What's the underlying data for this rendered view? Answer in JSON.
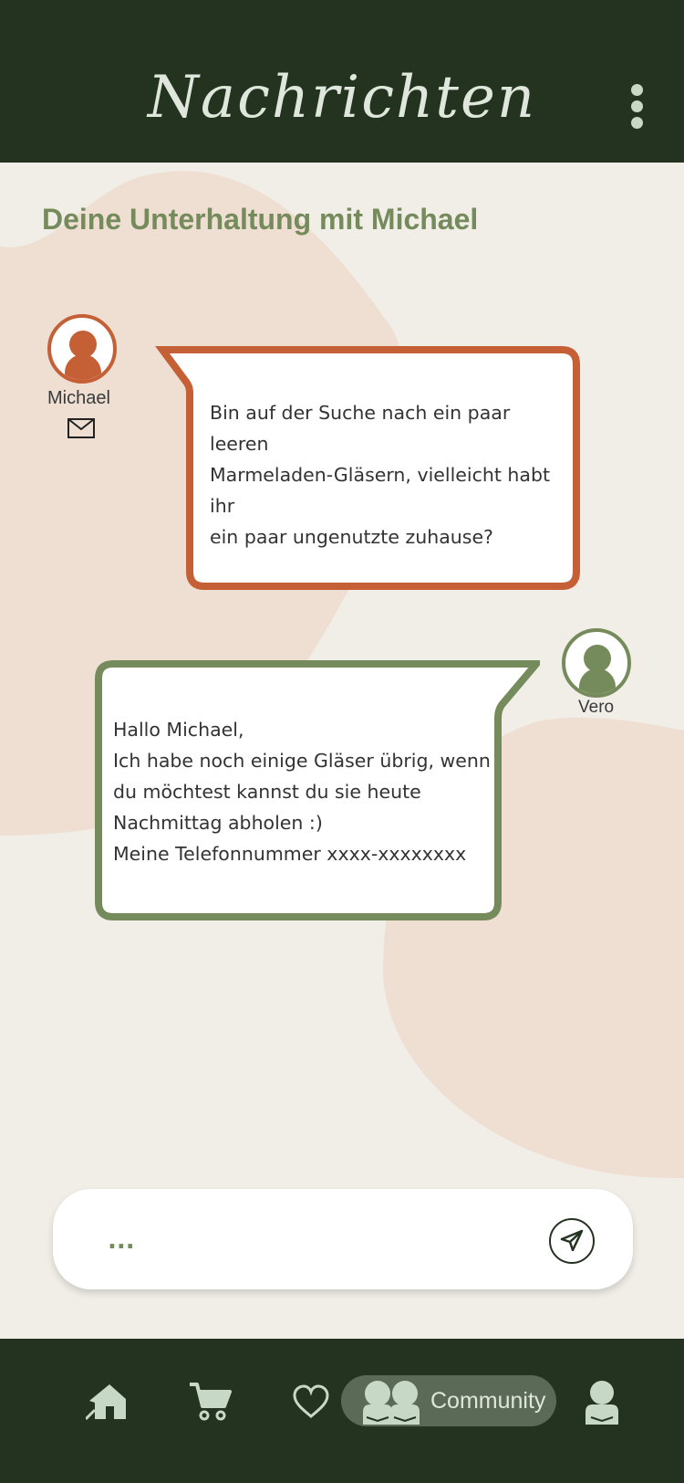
{
  "header": {
    "title": "Nachrichten",
    "menu_icon": "more-vertical-icon"
  },
  "conversation": {
    "title": "Deine Unterhaltung mit Michael"
  },
  "messages": [
    {
      "sender": "Michael",
      "text": "Bin auf der Suche nach ein paar leeren\nMarmeladen-Gläsern, vielleicht habt ihr\nein paar ungenutzte zuhause?",
      "color": "#c55f36"
    },
    {
      "sender": "Vero",
      "text": "Hallo Michael,\nIch habe noch einige Gläser übrig, wenn\ndu möchtest kannst du sie heute\nNachmittag abholen :)\nMeine Telefonnummer xxxx-xxxxxxxx",
      "color": "#768b5c"
    }
  ],
  "input": {
    "placeholder": "..."
  },
  "nav": {
    "items": [
      "home",
      "cart",
      "favorites",
      "community",
      "profile"
    ],
    "community_label": "Community"
  },
  "colors": {
    "header_bg": "#243220",
    "accent_green": "#768b5c",
    "accent_orange": "#c55f36",
    "background": "#f1ede7",
    "blob": "#eedfd2"
  }
}
